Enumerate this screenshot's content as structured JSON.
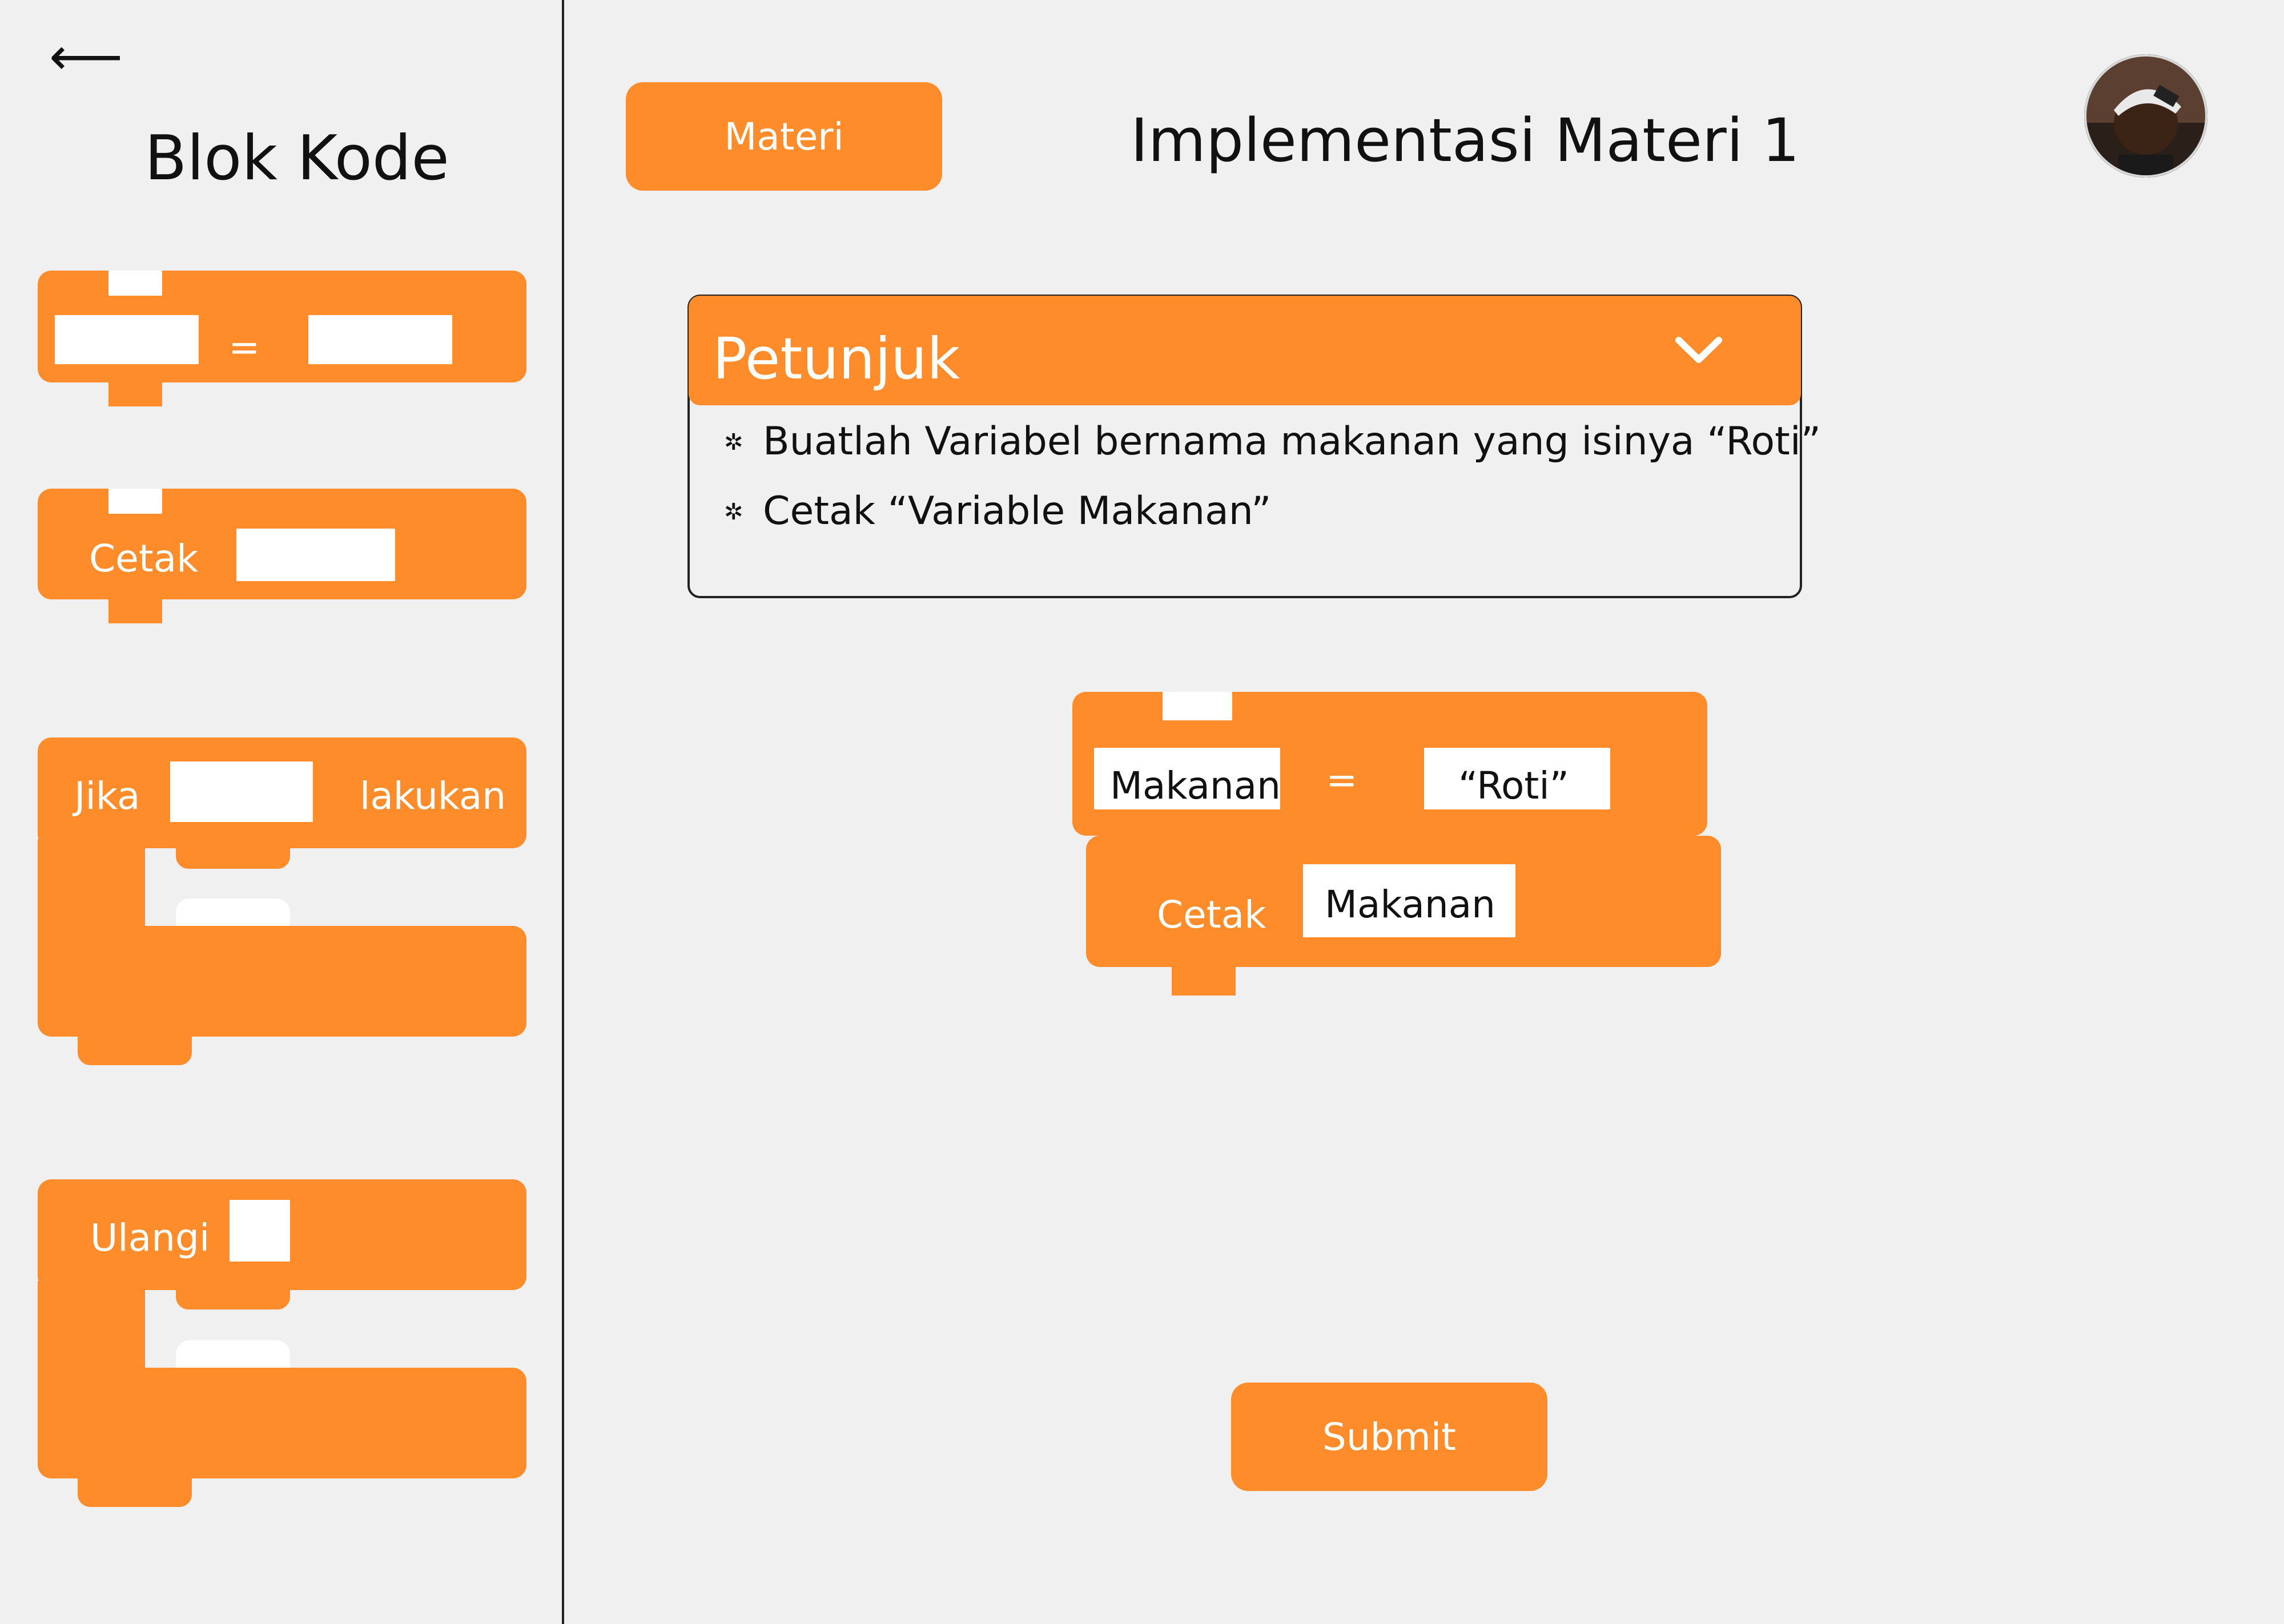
{
  "nav": {
    "back_label": "⟵"
  },
  "sidebar": {
    "title": "Blok Kode",
    "blocks": {
      "assign": {
        "operator": "="
      },
      "print": {
        "label": "Cetak"
      },
      "if": {
        "label": "Jika",
        "action_label": "lakukan"
      },
      "loop": {
        "label": "Ulangi"
      }
    }
  },
  "header": {
    "materi_button": "Materi",
    "title": "Implementasi Materi 1",
    "avatar_icon": "user-avatar"
  },
  "hints": {
    "title": "Petunjuk",
    "toggle_icon": "chevron-down-icon",
    "items": [
      "Buatlah Variabel bernama makanan yang isinya “Roti”",
      "Cetak “Variable Makanan”"
    ]
  },
  "workspace": {
    "assign_block": {
      "variable": "Makanan",
      "operator": "=",
      "value": "“Roti”"
    },
    "print_block": {
      "label": "Cetak",
      "value": "Makanan"
    }
  },
  "footer": {
    "submit_label": "Submit"
  },
  "colors": {
    "accent": "#ff8c2a",
    "background": "#f0f0f0",
    "text": "#111111"
  }
}
